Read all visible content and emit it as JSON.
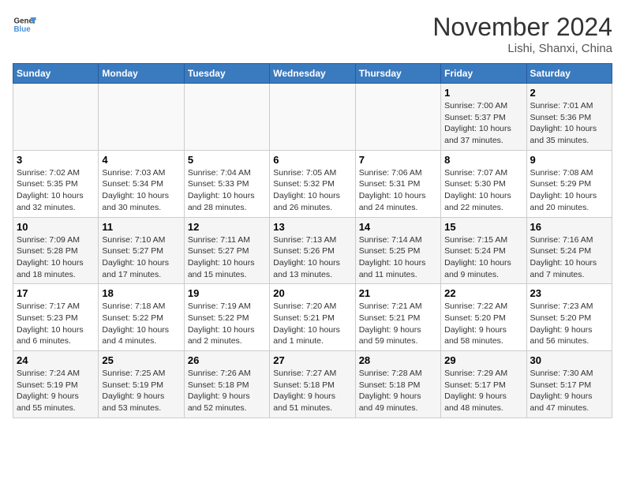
{
  "header": {
    "logo_line1": "General",
    "logo_line2": "Blue",
    "month": "November 2024",
    "location": "Lishi, Shanxi, China"
  },
  "weekdays": [
    "Sunday",
    "Monday",
    "Tuesday",
    "Wednesday",
    "Thursday",
    "Friday",
    "Saturday"
  ],
  "weeks": [
    [
      {
        "day": "",
        "info": ""
      },
      {
        "day": "",
        "info": ""
      },
      {
        "day": "",
        "info": ""
      },
      {
        "day": "",
        "info": ""
      },
      {
        "day": "",
        "info": ""
      },
      {
        "day": "1",
        "info": "Sunrise: 7:00 AM\nSunset: 5:37 PM\nDaylight: 10 hours\nand 37 minutes."
      },
      {
        "day": "2",
        "info": "Sunrise: 7:01 AM\nSunset: 5:36 PM\nDaylight: 10 hours\nand 35 minutes."
      }
    ],
    [
      {
        "day": "3",
        "info": "Sunrise: 7:02 AM\nSunset: 5:35 PM\nDaylight: 10 hours\nand 32 minutes."
      },
      {
        "day": "4",
        "info": "Sunrise: 7:03 AM\nSunset: 5:34 PM\nDaylight: 10 hours\nand 30 minutes."
      },
      {
        "day": "5",
        "info": "Sunrise: 7:04 AM\nSunset: 5:33 PM\nDaylight: 10 hours\nand 28 minutes."
      },
      {
        "day": "6",
        "info": "Sunrise: 7:05 AM\nSunset: 5:32 PM\nDaylight: 10 hours\nand 26 minutes."
      },
      {
        "day": "7",
        "info": "Sunrise: 7:06 AM\nSunset: 5:31 PM\nDaylight: 10 hours\nand 24 minutes."
      },
      {
        "day": "8",
        "info": "Sunrise: 7:07 AM\nSunset: 5:30 PM\nDaylight: 10 hours\nand 22 minutes."
      },
      {
        "day": "9",
        "info": "Sunrise: 7:08 AM\nSunset: 5:29 PM\nDaylight: 10 hours\nand 20 minutes."
      }
    ],
    [
      {
        "day": "10",
        "info": "Sunrise: 7:09 AM\nSunset: 5:28 PM\nDaylight: 10 hours\nand 18 minutes."
      },
      {
        "day": "11",
        "info": "Sunrise: 7:10 AM\nSunset: 5:27 PM\nDaylight: 10 hours\nand 17 minutes."
      },
      {
        "day": "12",
        "info": "Sunrise: 7:11 AM\nSunset: 5:27 PM\nDaylight: 10 hours\nand 15 minutes."
      },
      {
        "day": "13",
        "info": "Sunrise: 7:13 AM\nSunset: 5:26 PM\nDaylight: 10 hours\nand 13 minutes."
      },
      {
        "day": "14",
        "info": "Sunrise: 7:14 AM\nSunset: 5:25 PM\nDaylight: 10 hours\nand 11 minutes."
      },
      {
        "day": "15",
        "info": "Sunrise: 7:15 AM\nSunset: 5:24 PM\nDaylight: 10 hours\nand 9 minutes."
      },
      {
        "day": "16",
        "info": "Sunrise: 7:16 AM\nSunset: 5:24 PM\nDaylight: 10 hours\nand 7 minutes."
      }
    ],
    [
      {
        "day": "17",
        "info": "Sunrise: 7:17 AM\nSunset: 5:23 PM\nDaylight: 10 hours\nand 6 minutes."
      },
      {
        "day": "18",
        "info": "Sunrise: 7:18 AM\nSunset: 5:22 PM\nDaylight: 10 hours\nand 4 minutes."
      },
      {
        "day": "19",
        "info": "Sunrise: 7:19 AM\nSunset: 5:22 PM\nDaylight: 10 hours\nand 2 minutes."
      },
      {
        "day": "20",
        "info": "Sunrise: 7:20 AM\nSunset: 5:21 PM\nDaylight: 10 hours\nand 1 minute."
      },
      {
        "day": "21",
        "info": "Sunrise: 7:21 AM\nSunset: 5:21 PM\nDaylight: 9 hours\nand 59 minutes."
      },
      {
        "day": "22",
        "info": "Sunrise: 7:22 AM\nSunset: 5:20 PM\nDaylight: 9 hours\nand 58 minutes."
      },
      {
        "day": "23",
        "info": "Sunrise: 7:23 AM\nSunset: 5:20 PM\nDaylight: 9 hours\nand 56 minutes."
      }
    ],
    [
      {
        "day": "24",
        "info": "Sunrise: 7:24 AM\nSunset: 5:19 PM\nDaylight: 9 hours\nand 55 minutes."
      },
      {
        "day": "25",
        "info": "Sunrise: 7:25 AM\nSunset: 5:19 PM\nDaylight: 9 hours\nand 53 minutes."
      },
      {
        "day": "26",
        "info": "Sunrise: 7:26 AM\nSunset: 5:18 PM\nDaylight: 9 hours\nand 52 minutes."
      },
      {
        "day": "27",
        "info": "Sunrise: 7:27 AM\nSunset: 5:18 PM\nDaylight: 9 hours\nand 51 minutes."
      },
      {
        "day": "28",
        "info": "Sunrise: 7:28 AM\nSunset: 5:18 PM\nDaylight: 9 hours\nand 49 minutes."
      },
      {
        "day": "29",
        "info": "Sunrise: 7:29 AM\nSunset: 5:17 PM\nDaylight: 9 hours\nand 48 minutes."
      },
      {
        "day": "30",
        "info": "Sunrise: 7:30 AM\nSunset: 5:17 PM\nDaylight: 9 hours\nand 47 minutes."
      }
    ]
  ]
}
